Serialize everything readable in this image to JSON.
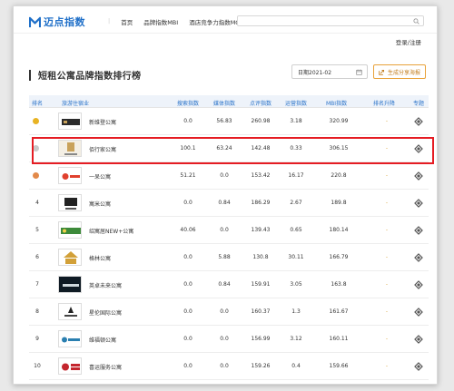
{
  "header": {
    "logo_text": "迈点指数",
    "nav": [
      "首页",
      "品牌指数MBI",
      "酒店竞争力指数MCI"
    ],
    "nav_separator": "|",
    "search_placeholder": "",
    "login": "登录/注册"
  },
  "page": {
    "title": "短租公寓品牌指数排行榜",
    "date_label": "日期2021-02",
    "share_label": "生成分享海报"
  },
  "table": {
    "columns": [
      "排名",
      "旅游住宿业",
      "搜索指数",
      "媒体指数",
      "点评指数",
      "运营指数",
      "MBI指数",
      "排名升降",
      "专题"
    ],
    "rows": [
      {
        "rank": "",
        "name": "新维登公寓",
        "search": "0.0",
        "media": "56.83",
        "review": "260.98",
        "ops": "3.18",
        "mbi": "320.99",
        "trend": "-"
      },
      {
        "rank": "",
        "name": "佰行家公寓",
        "search": "100.1",
        "media": "63.24",
        "review": "142.48",
        "ops": "0.33",
        "mbi": "306.15",
        "trend": "-"
      },
      {
        "rank": "",
        "name": "一呆公寓",
        "search": "51.21",
        "media": "0.0",
        "review": "153.42",
        "ops": "16.17",
        "mbi": "220.8",
        "trend": "-"
      },
      {
        "rank": "4",
        "name": "寓米公寓",
        "search": "0.0",
        "media": "0.84",
        "review": "186.29",
        "ops": "2.67",
        "mbi": "189.8",
        "trend": "-"
      },
      {
        "rank": "5",
        "name": "绍寓居NEW+公寓",
        "search": "40.06",
        "media": "0.0",
        "review": "139.43",
        "ops": "0.65",
        "mbi": "180.14",
        "trend": "-"
      },
      {
        "rank": "6",
        "name": "格林公寓",
        "search": "0.0",
        "media": "5.88",
        "review": "130.8",
        "ops": "30.11",
        "mbi": "166.79",
        "trend": "-"
      },
      {
        "rank": "7",
        "name": "英卓未来公寓",
        "search": "0.0",
        "media": "0.84",
        "review": "159.91",
        "ops": "3.05",
        "mbi": "163.8",
        "trend": "-"
      },
      {
        "rank": "8",
        "name": "星伦国际公寓",
        "search": "0.0",
        "media": "0.0",
        "review": "160.37",
        "ops": "1.3",
        "mbi": "161.67",
        "trend": "-"
      },
      {
        "rank": "9",
        "name": "维福顿公寓",
        "search": "0.0",
        "media": "0.0",
        "review": "156.99",
        "ops": "3.12",
        "mbi": "160.11",
        "trend": "-"
      },
      {
        "rank": "10",
        "name": "喜运服务公寓",
        "search": "0.0",
        "media": "0.0",
        "review": "159.26",
        "ops": "0.4",
        "mbi": "159.66",
        "trend": "-"
      }
    ]
  },
  "colors": {
    "accent": "#2a73c9",
    "highlight": "#e51c23",
    "share_border": "#e8a23a",
    "gold": "#e8b323",
    "silver": "#c9c9c9",
    "bronze": "#e2894a"
  }
}
